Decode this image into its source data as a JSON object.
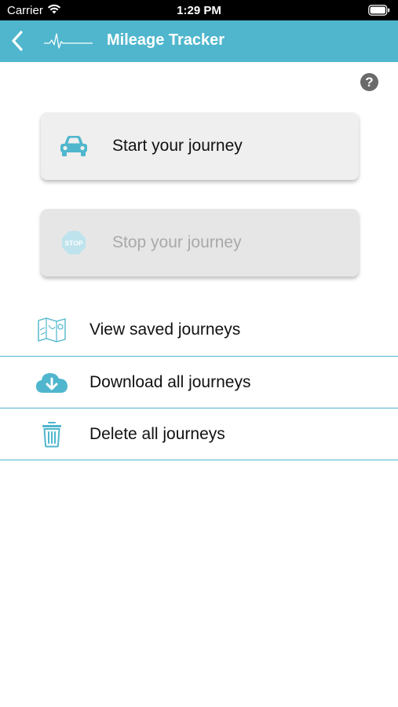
{
  "status_bar": {
    "carrier": "Carrier",
    "time": "1:29 PM"
  },
  "nav": {
    "title": "Mileage Tracker"
  },
  "actions": {
    "start_label": "Start your journey",
    "stop_label": "Stop your journey",
    "stop_sign_text": "STOP"
  },
  "menu": [
    {
      "label": "View saved journeys",
      "icon": "map-icon"
    },
    {
      "label": "Download all journeys",
      "icon": "cloud-download-icon"
    },
    {
      "label": "Delete all journeys",
      "icon": "trash-icon"
    }
  ],
  "help": {
    "symbol": "?"
  },
  "colors": {
    "accent": "#4fb6cd",
    "button_bg": "#efefef",
    "disabled_text": "#a9a9a9"
  }
}
